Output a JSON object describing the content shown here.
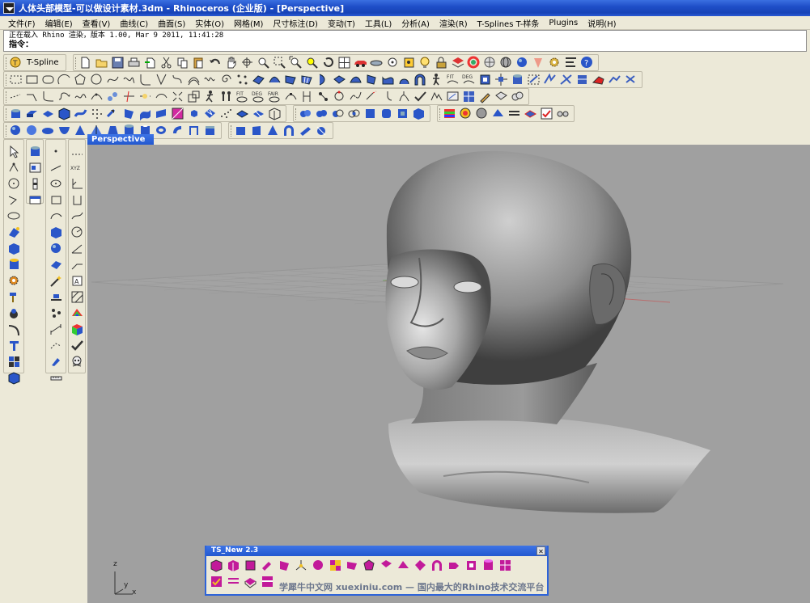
{
  "window": {
    "title": "人体头部模型-可以做设计素材.3dm - Rhinoceros (企业版) - [Perspective]"
  },
  "menu": [
    "文件(F)",
    "编辑(E)",
    "查看(V)",
    "曲线(C)",
    "曲面(S)",
    "实体(O)",
    "网格(M)",
    "尺寸标注(D)",
    "变动(T)",
    "工具(L)",
    "分析(A)",
    "渲染(R)",
    "T-Splines T-样条",
    "Plugins",
    "说明(H)"
  ],
  "command_area": {
    "history_line": "正在载入 Rhino 渲染，版本 1.00, Mar  9 2011, 11:41:28",
    "prompt_label": "指令："
  },
  "toolbar": {
    "tspline_label": "T-Spline"
  },
  "viewport": {
    "tab_label": "Perspective",
    "axis_z": "z",
    "axis_y": "y",
    "axis_x": "x"
  },
  "ts_toolbar": {
    "title": "TS_New 2.3",
    "close_glyph": "✕"
  },
  "watermark": "学犀牛中文网  xuexiniu.com  —  国内最大的Rhino技术交流平台",
  "colors": {
    "title_bar": "#1f4fc8",
    "viewport_bg": "#a0a0a0",
    "toolbar_bg": "#ece9d8"
  }
}
